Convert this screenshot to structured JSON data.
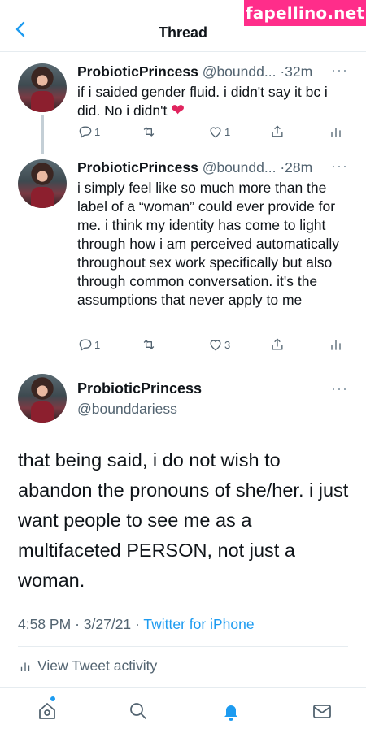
{
  "watermark": "fapellino.net",
  "header": {
    "title": "Thread"
  },
  "colors": {
    "accent": "#1d9bf0",
    "heart": "#e0245e",
    "watermark_bg": "#ff2d8a"
  },
  "tweets": [
    {
      "name": "ProbioticPrincess",
      "handle": "@boundd...",
      "dot": "·",
      "time": "32m",
      "text": "if i saided gender fluid. i didn't say it bc i did. No i didn't",
      "emoji": "❤",
      "replies": "1",
      "retweets": "",
      "likes": "1"
    },
    {
      "name": "ProbioticPrincess",
      "handle": "@boundd...",
      "dot": "·",
      "time": "28m",
      "text": "i simply feel like so much more than the label of a “woman” could ever provide for me. i think my identity has come to light through how i am perceived automatically throughout sex work specifically but also through common conversation. it's the assumptions that never apply to me",
      "replies": "1",
      "retweets": "",
      "likes": "3"
    }
  ],
  "main_tweet": {
    "name": "ProbioticPrincess",
    "handle": "@bounddariess",
    "text": "that being said, i do not wish to abandon the pronouns of she/her. i just want people to see me as a multifaceted PERSON, not just a woman.",
    "time": "4:58 PM",
    "dot": "·",
    "date": "3/27/21",
    "dot2": "·",
    "source": "Twitter for iPhone",
    "activity_label": "View Tweet activity"
  },
  "tabs": [
    "home-icon",
    "search-icon",
    "notifications-icon",
    "messages-icon"
  ]
}
